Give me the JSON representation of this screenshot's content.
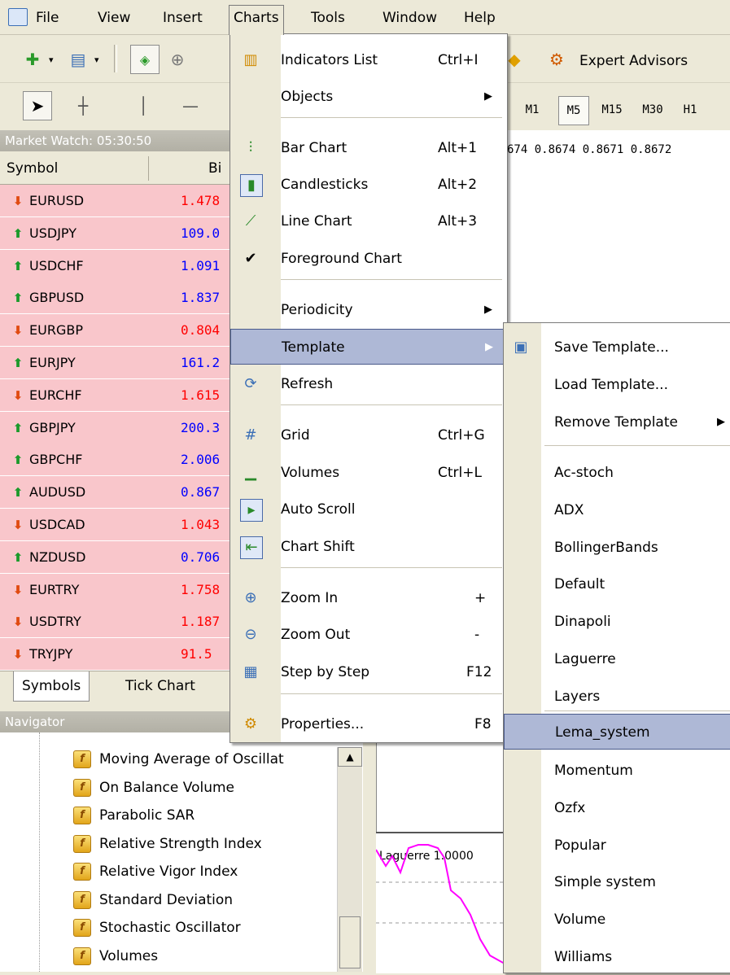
{
  "menubar": {
    "file": "File",
    "view": "View",
    "insert": "Insert",
    "charts": "Charts",
    "tools": "Tools",
    "window": "Window",
    "help": "Help"
  },
  "toolbar": {
    "expert_advisors": "Expert Advisors"
  },
  "timeframes": [
    "M1",
    "M5",
    "M15",
    "M30",
    "H1"
  ],
  "chart_info": "674 0.8674 0.8671 0.8672",
  "indicator_label": "Laguerre 1.0000",
  "market_watch": {
    "title": "Market Watch: 05:30:50",
    "col_symbol": "Symbol",
    "col_bid": "Bi",
    "rows": [
      {
        "symbol": "EURUSD",
        "bid": "1.478",
        "dir": "down"
      },
      {
        "symbol": "USDJPY",
        "bid": "109.0",
        "dir": "up"
      },
      {
        "symbol": "USDCHF",
        "bid": "1.091",
        "dir": "up"
      },
      {
        "symbol": "GBPUSD",
        "bid": "1.837",
        "dir": "up"
      },
      {
        "symbol": "EURGBP",
        "bid": "0.804",
        "dir": "down"
      },
      {
        "symbol": "EURJPY",
        "bid": "161.2",
        "dir": "up"
      },
      {
        "symbol": "EURCHF",
        "bid": "1.615",
        "dir": "down"
      },
      {
        "symbol": "GBPJPY",
        "bid": "200.3",
        "dir": "up"
      },
      {
        "symbol": "GBPCHF",
        "bid": "2.006",
        "dir": "up"
      },
      {
        "symbol": "AUDUSD",
        "bid": "0.867",
        "dir": "up"
      },
      {
        "symbol": "USDCAD",
        "bid": "1.043",
        "dir": "down"
      },
      {
        "symbol": "NZDUSD",
        "bid": "0.706",
        "dir": "up"
      },
      {
        "symbol": "EURTRY",
        "bid": "1.758",
        "dir": "down"
      },
      {
        "symbol": "USDTRY",
        "bid": "1.187",
        "dir": "down"
      },
      {
        "symbol": "TRYJPY",
        "bid": "91.5",
        "dir": "down"
      }
    ],
    "tabs": [
      "Symbols",
      "Tick Chart"
    ]
  },
  "navigator": {
    "title": "Navigator",
    "items": [
      "Moving Average of Oscillat",
      "On Balance Volume",
      "Parabolic SAR",
      "Relative Strength Index",
      "Relative Vigor Index",
      "Standard Deviation",
      "Stochastic Oscillator",
      "Volumes"
    ]
  },
  "charts_menu": {
    "items": [
      {
        "label": "Indicators List",
        "shortcut": "Ctrl+I"
      },
      {
        "label": "Objects",
        "submenu": true
      },
      {
        "label": "Bar Chart",
        "shortcut": "Alt+1"
      },
      {
        "label": "Candlesticks",
        "shortcut": "Alt+2"
      },
      {
        "label": "Line Chart",
        "shortcut": "Alt+3"
      },
      {
        "label": "Foreground Chart",
        "checked": true
      },
      {
        "label": "Periodicity",
        "submenu": true
      },
      {
        "label": "Template",
        "submenu": true,
        "highlighted": true
      },
      {
        "label": "Refresh"
      },
      {
        "label": "Grid",
        "shortcut": "Ctrl+G"
      },
      {
        "label": "Volumes",
        "shortcut": "Ctrl+L"
      },
      {
        "label": "Auto Scroll"
      },
      {
        "label": "Chart Shift"
      },
      {
        "label": "Zoom In",
        "shortcut": "+"
      },
      {
        "label": "Zoom Out",
        "shortcut": "-"
      },
      {
        "label": "Step by Step",
        "shortcut": "F12"
      },
      {
        "label": "Properties...",
        "shortcut": "F8"
      }
    ]
  },
  "template_menu": {
    "items": [
      "Save Template...",
      "Load Template...",
      "Remove Template",
      "Ac-stoch",
      "ADX",
      "BollingerBands",
      "Default",
      "Dinapoli",
      "Laguerre",
      "Layers",
      "Lema_system",
      "Momentum",
      "Ozfx",
      "Popular",
      "Simple system",
      "Volume",
      "Williams"
    ],
    "highlighted": "Lema_system"
  },
  "colors": {
    "row_bg": "#f9c6cb",
    "bid_down": "#ff0000",
    "bid_up": "#0000ff",
    "menu_highlight": "#aeb8d6",
    "indicator_line": "#ff00ff"
  }
}
